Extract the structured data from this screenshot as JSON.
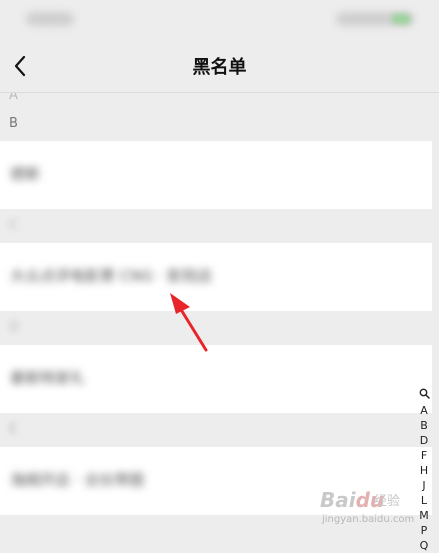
{
  "nav": {
    "title": "黑名单",
    "back_icon": "chevron-left-icon"
  },
  "list": {
    "top_partial_header": "A",
    "sections": [
      {
        "header": "B",
        "blurred": false,
        "rows": [
          "德斯"
        ]
      },
      {
        "header": "C",
        "blurred": true,
        "rows": [
          "大众点评电影票 CNG · 影院店"
        ]
      },
      {
        "header": "D",
        "blurred": true,
        "rows": [
          "豪斯特家礼"
        ]
      },
      {
        "header": "E",
        "blurred": true,
        "rows": [
          "海姆开店 · 合伙带图"
        ]
      }
    ]
  },
  "index_bar": {
    "search_icon": "search-icon",
    "letters": [
      "A",
      "B",
      "D",
      "F",
      "H",
      "J",
      "L",
      "M",
      "P",
      "Q"
    ]
  },
  "annotation": {
    "color": "#e8262a",
    "icon": "red-arrow-icon"
  },
  "watermark": {
    "logo": "Bai",
    "logo_accent": "du",
    "text": "经验",
    "url": "jingyan.baidu.com"
  }
}
